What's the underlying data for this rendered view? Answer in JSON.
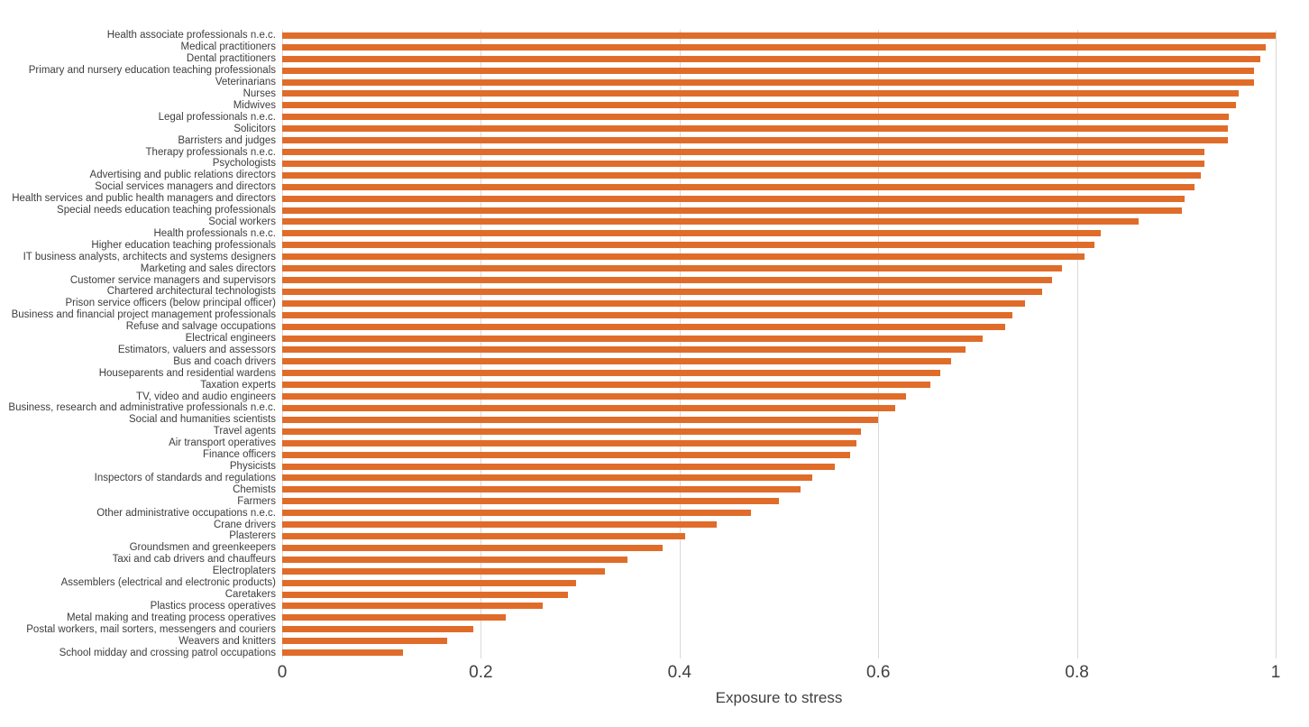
{
  "chart_data": {
    "type": "bar",
    "orientation": "horizontal",
    "title": "",
    "subtitle": "",
    "xlabel": "Exposure to stress",
    "ylabel": "",
    "xlim": [
      0,
      1
    ],
    "ylim": null,
    "xticks": [
      "0",
      "0.2",
      "0.4",
      "0.6",
      "0.8",
      "1"
    ],
    "xtick_values": [
      0,
      0.2,
      0.4,
      0.6,
      0.8,
      1
    ],
    "grid": "vertical",
    "legend": "none",
    "bar_color": "#e06c2a",
    "gridline_color": "#d9d9d9",
    "text_color": "#3d3d3d",
    "categories": [
      "Health associate professionals n.e.c.",
      "Medical practitioners",
      "Dental practitioners",
      "Primary and nursery education teaching professionals",
      "Veterinarians",
      "Nurses",
      "Midwives",
      "Legal professionals n.e.c.",
      "Solicitors",
      "Barristers and judges",
      "Therapy professionals n.e.c.",
      "Psychologists",
      "Advertising and public relations directors",
      "Social services managers and directors",
      "Health services and public health managers and directors",
      "Special needs education teaching professionals",
      "Social workers",
      "Health professionals n.e.c.",
      "Higher education teaching professionals",
      "IT business analysts, architects and systems designers",
      "Marketing and sales directors",
      "Customer service managers and supervisors",
      "Chartered architectural technologists",
      "Prison service officers (below principal officer)",
      "Business and financial project management professionals",
      "Refuse and salvage occupations",
      "Electrical engineers",
      "Estimators, valuers and assessors",
      "Bus and coach drivers",
      "Houseparents and residential wardens",
      "Taxation experts",
      "TV, video and audio engineers",
      "Business, research and administrative professionals n.e.c.",
      "Social and humanities scientists",
      "Travel agents",
      "Air transport operatives",
      "Finance officers",
      "Physicists",
      "Inspectors of standards and regulations",
      "Chemists",
      "Farmers",
      "Other administrative occupations n.e.c.",
      "Crane drivers",
      "Plasterers",
      "Groundsmen and greenkeepers",
      "Taxi and cab drivers and chauffeurs",
      "Electroplaters",
      "Assemblers (electrical and electronic products)",
      "Caretakers",
      "Plastics process operatives",
      "Metal making and treating process operatives",
      "Postal workers, mail sorters, messengers and couriers",
      "Weavers and knitters",
      "School midday and crossing patrol occupations"
    ],
    "values": [
      1.0,
      0.99,
      0.985,
      0.978,
      0.978,
      0.963,
      0.96,
      0.953,
      0.952,
      0.952,
      0.928,
      0.928,
      0.925,
      0.918,
      0.908,
      0.906,
      0.862,
      0.824,
      0.818,
      0.808,
      0.785,
      0.775,
      0.765,
      0.748,
      0.735,
      0.728,
      0.705,
      0.688,
      0.673,
      0.662,
      0.652,
      0.628,
      0.617,
      0.6,
      0.583,
      0.578,
      0.572,
      0.556,
      0.534,
      0.522,
      0.5,
      0.472,
      0.437,
      0.406,
      0.383,
      0.348,
      0.325,
      0.296,
      0.288,
      0.262,
      0.225,
      0.192,
      0.166,
      0.122
    ]
  }
}
